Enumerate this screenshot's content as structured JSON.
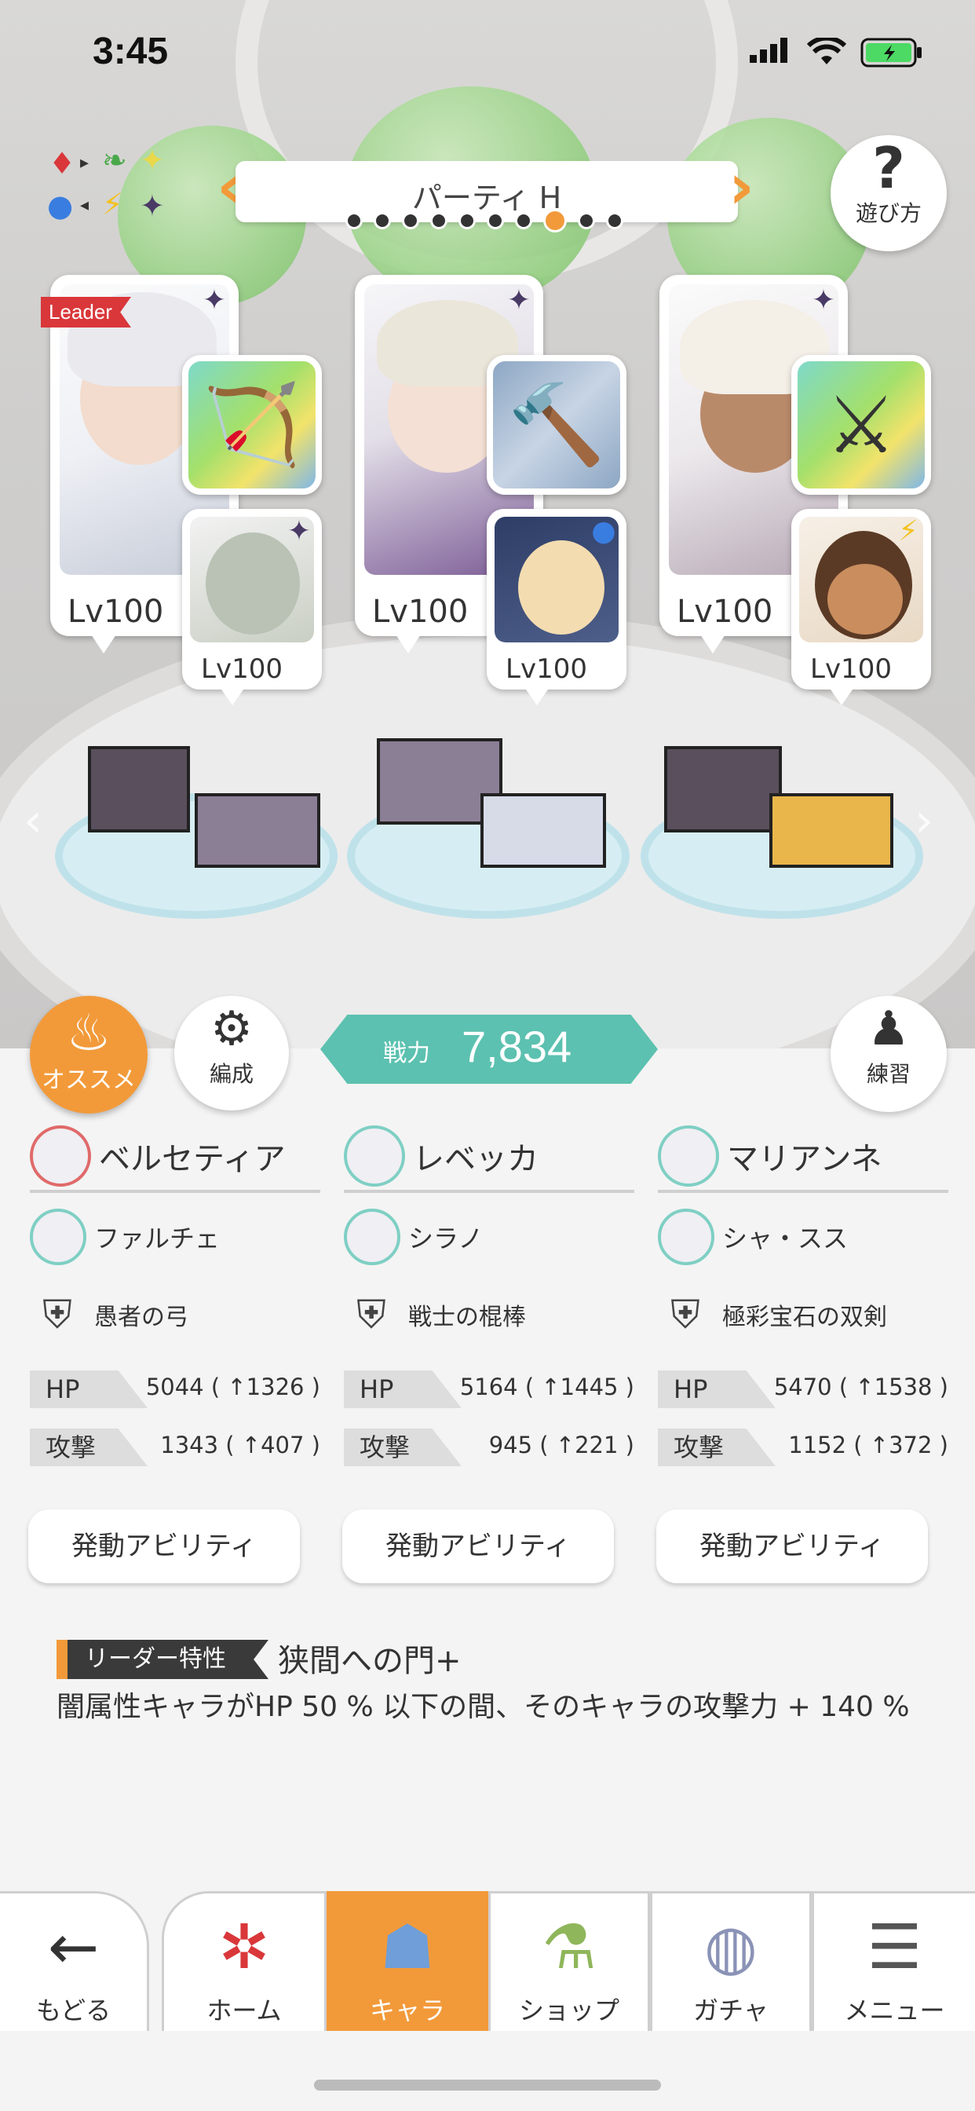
{
  "status_bar": {
    "time": "3:45"
  },
  "header": {
    "party_name": "パーティ H",
    "party_count": 10,
    "party_active_index": 7,
    "help_label": "遊び方",
    "help_glyph": "?"
  },
  "element_cycle": [
    "♦",
    "▸",
    "❧",
    "✦",
    "●",
    "◂",
    "⚡",
    "✦"
  ],
  "formation": {
    "leader_tag": "Leader",
    "slots": [
      {
        "main_level": "Lv100",
        "sub_level": "Lv100",
        "main_element": "dark",
        "sub_element": "dark",
        "weapon_icon": "bow-icon"
      },
      {
        "main_level": "Lv100",
        "sub_level": "Lv100",
        "main_element": "dark",
        "sub_element": "water",
        "weapon_icon": "staff-icon"
      },
      {
        "main_level": "Lv100",
        "sub_level": "Lv100",
        "main_element": "dark",
        "sub_element": "thunder",
        "weapon_icon": "twin-swords-icon"
      }
    ]
  },
  "actions": {
    "recommend_label": "オススメ",
    "formation_label": "編成",
    "practice_label": "練習",
    "power_label": "戦力",
    "power_value": "7,834"
  },
  "team": [
    {
      "main_name": "ベルセティア",
      "sub_name": "ファルチェ",
      "weapon_name": "愚者の弓",
      "hp_label": "HP",
      "hp_value": "5044 ( ↑1326 )",
      "atk_label": "攻撃",
      "atk_value": "1343 ( ↑407 )",
      "ability_label": "発動アビリティ"
    },
    {
      "main_name": "レベッカ",
      "sub_name": "シラノ",
      "weapon_name": "戦士の棍棒",
      "hp_label": "HP",
      "hp_value": "5164 ( ↑1445 )",
      "atk_label": "攻撃",
      "atk_value": "945 ( ↑221 )",
      "ability_label": "発動アビリティ"
    },
    {
      "main_name": "マリアンネ",
      "sub_name": "シャ・スス",
      "weapon_name": "極彩宝石の双剣",
      "hp_label": "HP",
      "hp_value": "5470 ( ↑1538 )",
      "atk_label": "攻撃",
      "atk_value": "1152 ( ↑372 )",
      "ability_label": "発動アビリティ"
    }
  ],
  "leader_skill": {
    "tag": "リーダー特性",
    "name": "狭間への門+",
    "description": "闇属性キャラがHP 50 % 以下の間、そのキャラの攻撃力 + 140 %"
  },
  "tabs": [
    {
      "id": "back",
      "label": "もどる",
      "icon": "back-arrow-icon"
    },
    {
      "id": "home",
      "label": "ホーム",
      "icon": "home-icon"
    },
    {
      "id": "chara",
      "label": "キャラ",
      "icon": "chara-icon",
      "active": true
    },
    {
      "id": "shop",
      "label": "ショップ",
      "icon": "shop-icon"
    },
    {
      "id": "gacha",
      "label": "ガチャ",
      "icon": "gacha-icon"
    },
    {
      "id": "menu",
      "label": "メニュー",
      "icon": "menu-icon"
    }
  ],
  "colors": {
    "accent": "#f29a3a",
    "power": "#5cc1b0",
    "leader": "#d9373a"
  }
}
